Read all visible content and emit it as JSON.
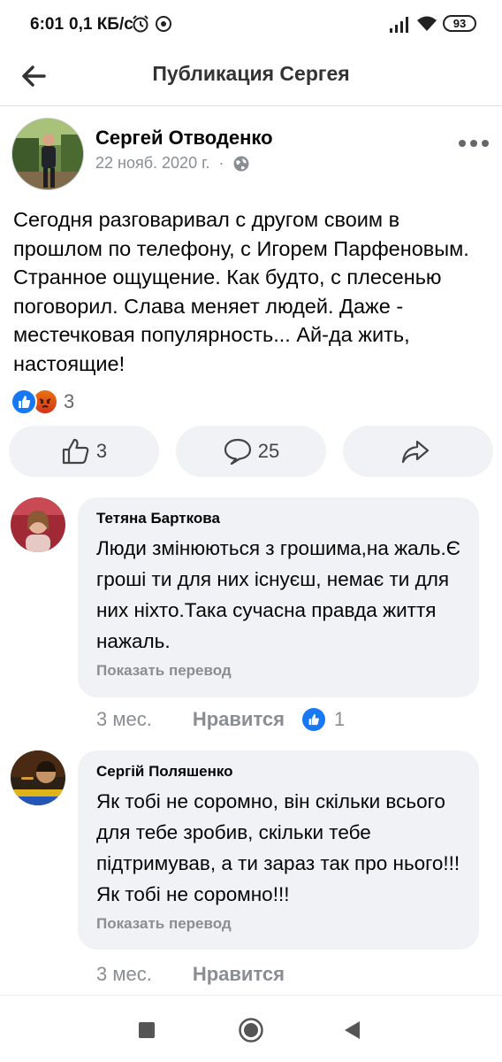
{
  "status_bar": {
    "time": "6:01",
    "speed": "0,1 КБ/с",
    "battery": "93",
    "icons": [
      "alarm-icon",
      "link-icon",
      "signal-icon",
      "wifi-icon",
      "battery-icon"
    ]
  },
  "header": {
    "title": "Публикация Сергея",
    "back_icon": "arrow-left-icon"
  },
  "post": {
    "author": "Сергей Отводенко",
    "date": "22 нояб. 2020 г.",
    "separator": "·",
    "privacy_icon": "globe-icon",
    "text": "Сегодня разговаривал  с другом своим в прошлом по телефону, с Игорем Парфеновым. Странное ощущение. Как будто, с плесенью поговорил. Слава меняет людей. Даже - местечковая популярность... Ай-да жить, настоящие!",
    "reactions": {
      "types": [
        "like",
        "angry"
      ],
      "count": "3",
      "colors": {
        "like": "#1877f2",
        "angry": "#e9710f"
      }
    },
    "actions": {
      "like_count": "3",
      "comment_count": "25"
    }
  },
  "comments": [
    {
      "author": "Тетяна Барткова",
      "text": "Люди змінюються з грошима,на жаль.Є гроші ти для них існуєш, немає ти для них ніхто.Така сучасна правда життя нажаль.",
      "translate": "Показать перевод",
      "time": "3 мес.",
      "like_label": "Нравится",
      "like_count": "1"
    },
    {
      "author": "Сергій Поляшенко",
      "text": "Як тобі не соромно, він скільки всього для тебе зробив,  скільки тебе підтримував, а ти зараз так про нього!!! Як тобі не соромно!!!",
      "translate": "Показать перевод",
      "time": "3 мес.",
      "like_label": "Нравится"
    }
  ],
  "nav": {
    "icons": [
      "recents-square-icon",
      "home-circle-icon",
      "back-triangle-icon"
    ]
  },
  "colors": {
    "accent": "#1877f2",
    "bubble": "#f0f2f5",
    "secondary_text": "#8a8d91"
  }
}
